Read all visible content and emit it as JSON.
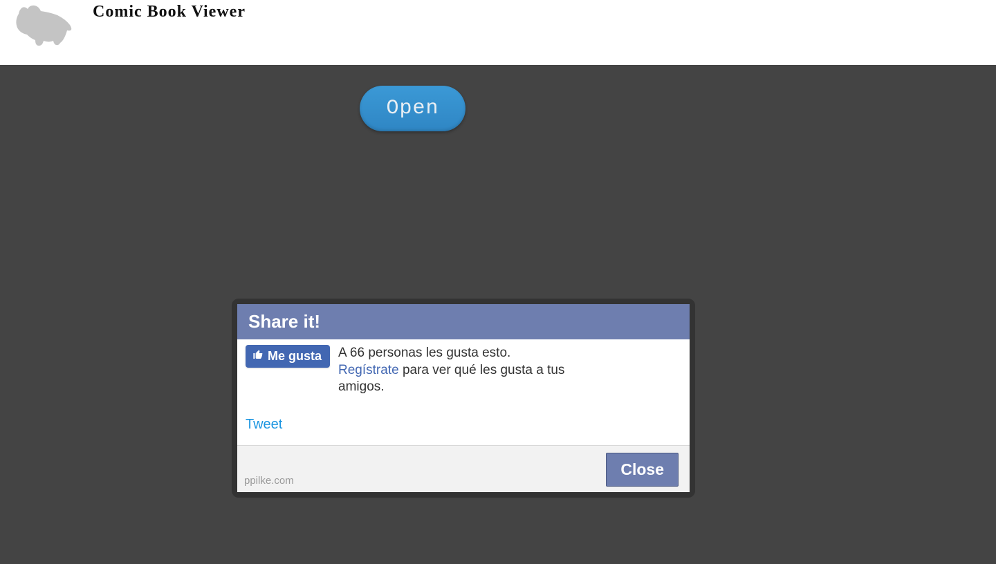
{
  "header": {
    "title": "Comic Book Viewer"
  },
  "toolbar": {
    "open_label": "Open"
  },
  "dialog": {
    "title": "Share it!",
    "fb_like_label": "Me gusta",
    "fb_text_pre": "A 66 personas les gusta esto. ",
    "fb_link": "Regístrate",
    "fb_text_post": " para ver qué les gusta a tus amigos.",
    "tweet_label": "Tweet",
    "footer_site": "ppilke.com",
    "close_label": "Close"
  }
}
